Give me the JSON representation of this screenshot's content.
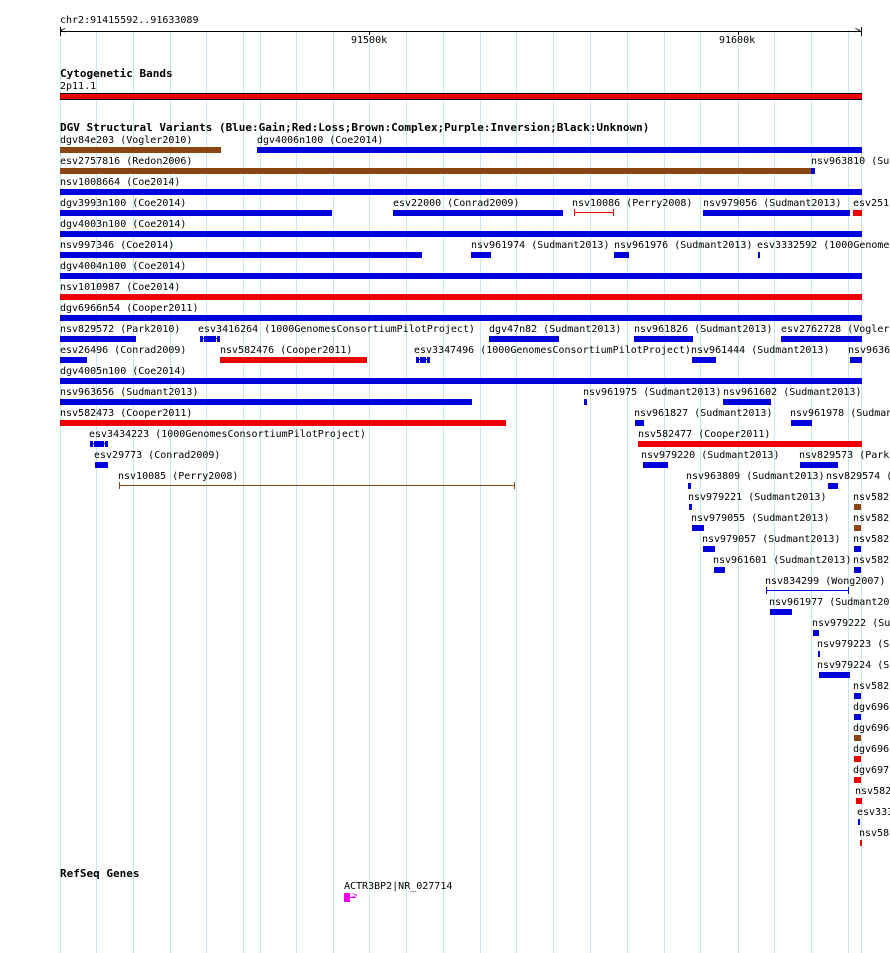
{
  "ruler": {
    "label": "chr2:91415592..91633089",
    "ticks": [
      "91500k",
      "91600k"
    ]
  },
  "tracks": {
    "cytobands": {
      "title": "Cytogenetic Bands",
      "band": {
        "label": "2p11.1",
        "color": "#ee0000"
      }
    },
    "dgv": {
      "title": "DGV Structural Variants (Blue:Gain;Red:Loss;Brown:Complex;Purple:Inversion;Black:Unknown)",
      "colors": {
        "gain": "#0000dd",
        "loss": "#ee0000",
        "complex": "#8b4513"
      },
      "labels": [
        "dgv84e203 (Vogler2010)",
        "dgv4006n100 (Coe2014)",
        "esv2757816 (Redon2006)",
        "nsv963810 (Sud",
        "nsv1008664 (Coe2014)",
        "dgv3993n100 (Coe2014)",
        "esv22000 (Conrad2009)",
        "nsv10086 (Perry2008)",
        "nsv979056 (Sudmant2013)",
        "esv251",
        "dgv4003n100 (Coe2014)",
        "nsv997346 (Coe2014)",
        "nsv961974 (Sudmant2013)",
        "nsv961976 (Sudmant2013)",
        "esv3332592 (1000Genome",
        "dgv4004n100 (Coe2014)",
        "nsv1010987 (Coe2014)",
        "dgv6966n54 (Cooper2011)",
        "nsv829572 (Park2010)",
        "esv3416264 (1000GenomesConsortiumPilotProject)",
        "dgv47n82 (Sudmant2013)",
        "nsv961826 (Sudmant2013)",
        "esv2762728 (Vogler",
        "esv26496 (Conrad2009)",
        "nsv582476 (Cooper2011)",
        "esv3347496 (1000GenomesConsortiumPilotProject)",
        "nsv961444 (Sudmant2013)",
        "nsv9636",
        "dgv4005n100 (Coe2014)",
        "nsv963656 (Sudmant2013)",
        "nsv961975 (Sudmant2013)",
        "nsv961602 (Sudmant2013)",
        "nsv582473 (Cooper2011)",
        "nsv961827 (Sudmant2013)",
        "nsv961978 (Sudmant",
        "esv3434223 (1000GenomesConsortiumPilotProject)",
        "nsv582477 (Cooper2011)",
        "esv29773 (Conrad2009)",
        "nsv979220 (Sudmant2013)",
        "nsv829573 (Park",
        "nsv10085 (Perry2008)",
        "nsv963809 (Sudmant2013)",
        "nsv829574 (",
        "nsv979221 (Sudmant2013)",
        "nsv582",
        "nsv979055 (Sudmant2013)",
        "nsv582",
        "nsv979057 (Sudmant2013)",
        "nsv582",
        "nsv961601 (Sudmant2013)",
        "nsv582",
        "nsv834299 (Wong2007)",
        "nsv961977 (Sudmant20",
        "nsv979222 (Su",
        "nsv979223 (S",
        "nsv979224 (S",
        "nsv582",
        "dgv696",
        "dgv696",
        "dgv696",
        "dgv697",
        "nsv582",
        "esv333",
        "nsv58"
      ]
    },
    "refseq": {
      "title": "RefSeq Genes",
      "gene": {
        "label": "ACTR3BP2|NR_027714",
        "color": "#ee00ee"
      }
    }
  }
}
